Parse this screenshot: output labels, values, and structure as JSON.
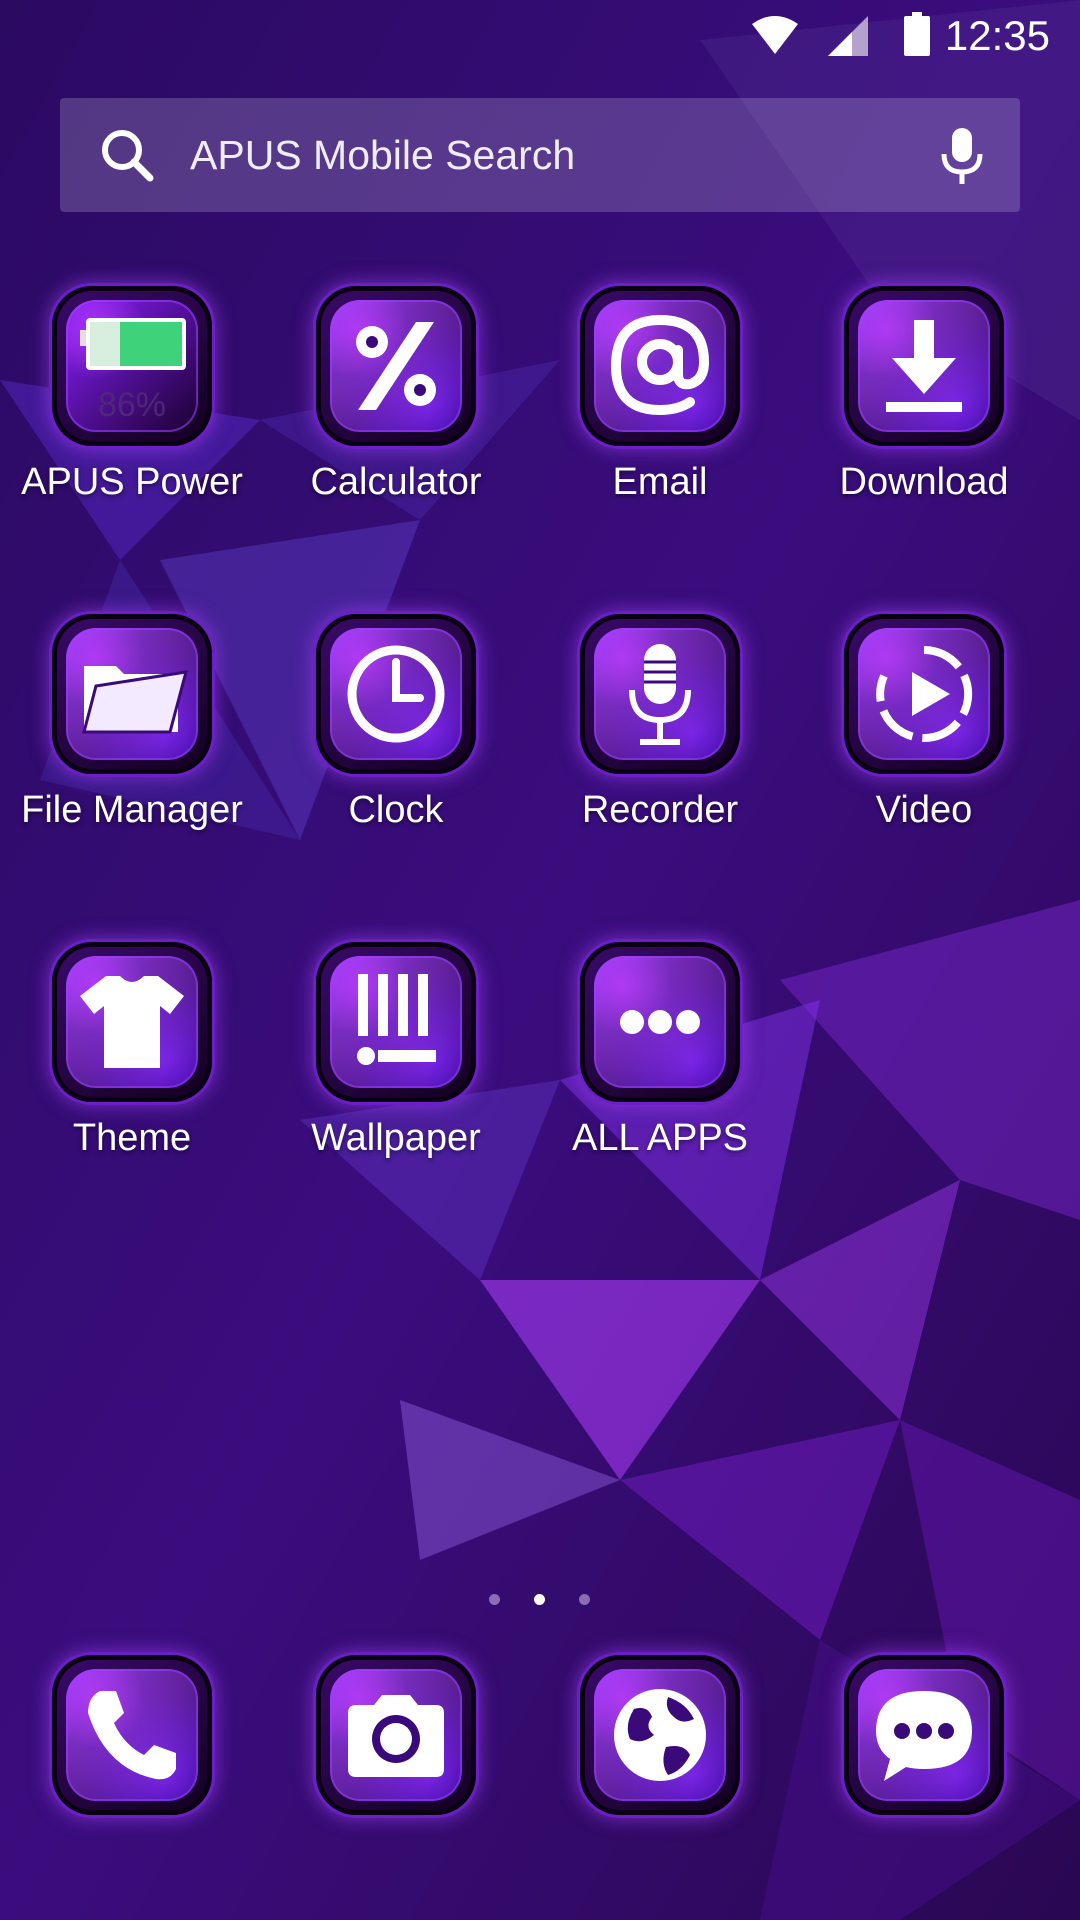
{
  "status_bar": {
    "time": "12:35"
  },
  "search": {
    "placeholder": "APUS Mobile Search"
  },
  "apps": [
    {
      "label": "APUS Power",
      "icon": "battery-icon",
      "badge": "86%"
    },
    {
      "label": "Calculator",
      "icon": "percent-icon"
    },
    {
      "label": "Email",
      "icon": "at-sign-icon"
    },
    {
      "label": "Download",
      "icon": "download-icon"
    },
    {
      "label": "File Manager",
      "icon": "folder-icon"
    },
    {
      "label": "Clock",
      "icon": "clock-icon"
    },
    {
      "label": "Recorder",
      "icon": "microphone-icon"
    },
    {
      "label": "Video",
      "icon": "play-icon"
    },
    {
      "label": "Theme",
      "icon": "tshirt-icon"
    },
    {
      "label": "Wallpaper",
      "icon": "wallpaper-icon"
    },
    {
      "label": "ALL APPS",
      "icon": "more-dots-icon"
    }
  ],
  "page_indicator": {
    "count": 3,
    "active": 1
  },
  "dock": [
    {
      "icon": "phone-icon"
    },
    {
      "icon": "camera-icon"
    },
    {
      "icon": "globe-icon"
    },
    {
      "icon": "chat-bubble-icon"
    }
  ],
  "colors": {
    "accent": "#7a2cff",
    "glow": "#b050ff",
    "background": "#2a0a55"
  }
}
